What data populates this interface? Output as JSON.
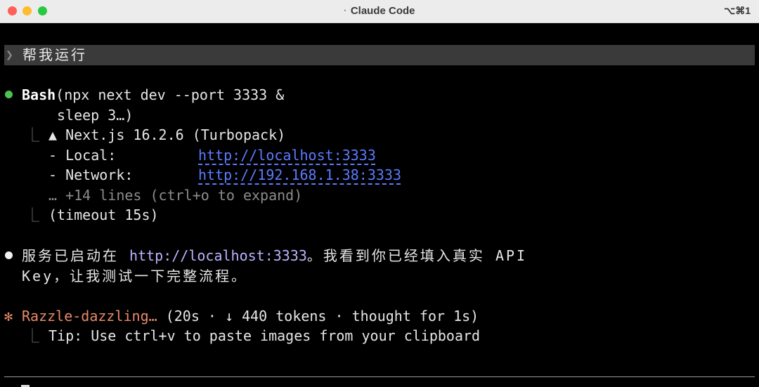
{
  "window": {
    "title": "Claude Code",
    "title_dot": "·",
    "shortcut": "⌥⌘1"
  },
  "prompt": {
    "arrow": "❯",
    "text": "帮我运行"
  },
  "tool_call": {
    "name": "Bash",
    "args_line1": "(npx next dev --port 3333 &",
    "args_line2": "sleep 3…)",
    "output": {
      "branch": "⎿",
      "line1": "▲ Next.js 16.2.6 (Turbopack)",
      "local_label": "- Local:",
      "local_url": "http://localhost:3333",
      "network_label": "- Network:",
      "network_url": "http://192.168.1.38:3333",
      "more": "… +14 lines (ctrl+o to expand)"
    },
    "timeout": "(timeout 15s)"
  },
  "message": {
    "part1": "服务已启动在 ",
    "url": "http://localhost:3333",
    "part2": "。我看到你已经填入真实 API",
    "line2": "Key，让我测试一下完整流程。"
  },
  "status": {
    "icon": "✻",
    "verb": "Razzle-dazzling…",
    "meta": " (20s · ↓ 440 tokens · thought for 1s)",
    "tip": "Tip: Use ctrl+v to paste images from your clipboard"
  },
  "colors": {
    "success_dot": "#4ec34e",
    "link": "#5b7cff",
    "status": "#e8896a"
  }
}
